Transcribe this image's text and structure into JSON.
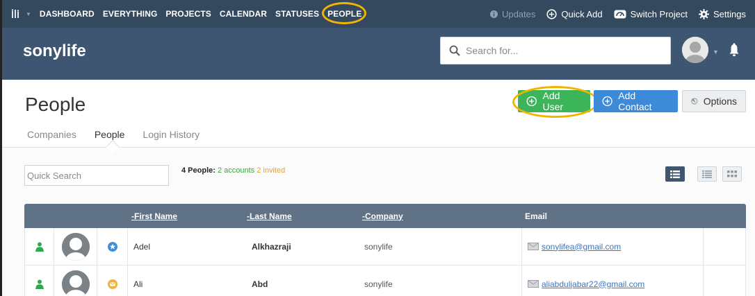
{
  "nav": {
    "items": [
      "DASHBOARD",
      "EVERYTHING",
      "PROJECTS",
      "CALENDAR",
      "STATUSES",
      "PEOPLE"
    ],
    "active": "PEOPLE",
    "updates": "Updates",
    "quick_add": "Quick Add",
    "switch_project": "Switch Project",
    "settings": "Settings"
  },
  "header": {
    "project_name": "sonylife",
    "search_placeholder": "Search for..."
  },
  "page": {
    "title": "People",
    "add_user": "Add User",
    "add_contact": "Add Contact",
    "options": "Options",
    "tabs": [
      "Companies",
      "People",
      "Login History"
    ],
    "active_tab": "People"
  },
  "filter": {
    "quick_search_placeholder": "Quick Search",
    "total": "4 People:",
    "accounts": "2 accounts",
    "invited": "2 invited"
  },
  "table": {
    "columns": {
      "first_name": "-First Name",
      "last_name": "-Last Name",
      "company": "-Company",
      "email": "Email"
    },
    "rows": [
      {
        "first_name": "Adel",
        "last_name": "Alkhazraji",
        "company": "sonylife",
        "email": "sonylifea@gmail.com",
        "type_icon": "star-badge-icon"
      },
      {
        "first_name": "Ali",
        "last_name": "Abd",
        "company": "sonylife",
        "email": "aliabduljabar22@gmail.com",
        "type_icon": "envelope-badge-icon"
      }
    ]
  },
  "colors": {
    "nav_bg": "#34495e",
    "header_bg": "#3f5673",
    "add_user_green": "#3cb45a",
    "add_contact_blue": "#3d8ad8",
    "highlight_ring": "#f3b400",
    "accounts_green": "#3aa33c",
    "invited_orange": "#e6a32e"
  }
}
